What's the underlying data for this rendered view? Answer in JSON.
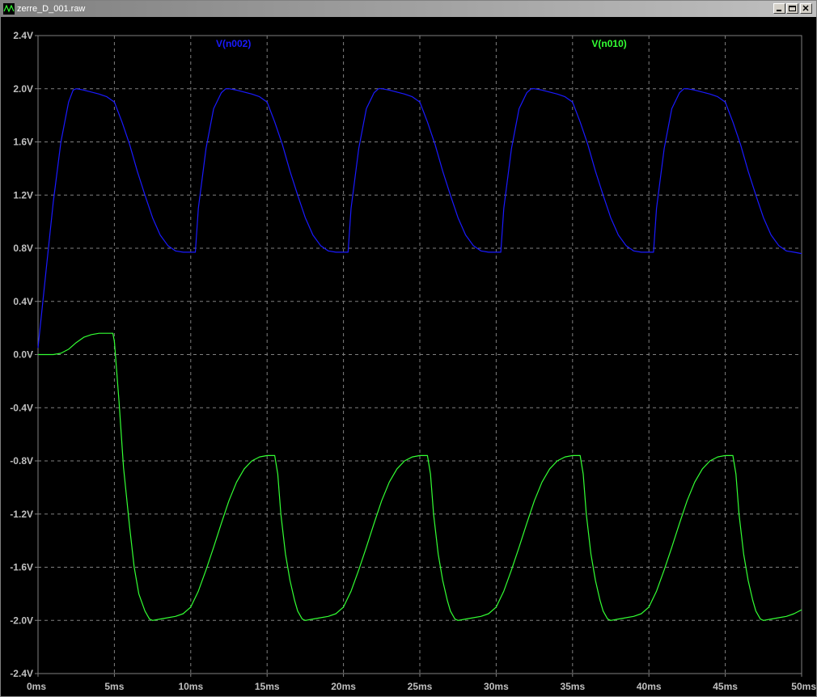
{
  "window": {
    "title": "zerre_D_001.raw",
    "buttons": [
      "minimize-icon",
      "restore-icon",
      "close-icon"
    ]
  },
  "colors": {
    "background": "#000000",
    "grid": "#808080",
    "axis": "#808080",
    "tick_text": "#c0c0c0",
    "series_n002": "#1a1aff",
    "series_n010": "#33ff33"
  },
  "chart_data": {
    "type": "line",
    "title": "",
    "xlabel": "",
    "ylabel": "",
    "x_unit": "ms",
    "y_unit": "V",
    "xlim": [
      0,
      50
    ],
    "ylim": [
      -2.4,
      2.4
    ],
    "x_ticks": [
      "0ms",
      "5ms",
      "10ms",
      "15ms",
      "20ms",
      "25ms",
      "30ms",
      "35ms",
      "40ms",
      "45ms",
      "50ms"
    ],
    "y_ticks": [
      "2.4V",
      "2.0V",
      "1.6V",
      "1.2V",
      "0.8V",
      "0.4V",
      "0.0V",
      "-0.4V",
      "-0.8V",
      "-1.2V",
      "-1.6V",
      "-2.0V",
      "-2.4V"
    ],
    "y_tick_values": [
      2.4,
      2.0,
      1.6,
      1.2,
      0.8,
      0.4,
      0.0,
      -0.4,
      -0.8,
      -1.2,
      -1.6,
      -2.0,
      -2.4
    ],
    "x_tick_values": [
      0,
      5,
      10,
      15,
      20,
      25,
      30,
      35,
      40,
      45,
      50
    ],
    "grid": true,
    "series": [
      {
        "name": "V(n002)",
        "color": "#1a1aff",
        "x": [
          0,
          0.5,
          1.0,
          1.5,
          2.0,
          2.3,
          2.5,
          3.0,
          4.0,
          4.5,
          5.0,
          5.5,
          6.0,
          6.5,
          7.0,
          7.5,
          8.0,
          8.5,
          9.0,
          9.5,
          10.0,
          10.3,
          10.5,
          11.0,
          11.5,
          12.0,
          12.3,
          12.5,
          13.0,
          14.0,
          14.5,
          15.0,
          15.5,
          16.0,
          16.5,
          17.0,
          17.5,
          18.0,
          18.5,
          19.0,
          19.5,
          20.0,
          20.3,
          20.5,
          21.0,
          21.5,
          22.0,
          22.3,
          22.5,
          23.0,
          24.0,
          24.5,
          25.0,
          25.5,
          26.0,
          26.5,
          27.0,
          27.5,
          28.0,
          28.5,
          29.0,
          29.5,
          30.0,
          30.3,
          30.5,
          31.0,
          31.5,
          32.0,
          32.3,
          32.5,
          33.0,
          34.0,
          34.5,
          35.0,
          35.5,
          36.0,
          36.5,
          37.0,
          37.5,
          38.0,
          38.5,
          39.0,
          39.5,
          40.0,
          40.3,
          40.5,
          41.0,
          41.5,
          42.0,
          42.3,
          42.5,
          43.0,
          44.0,
          44.5,
          45.0,
          45.5,
          46.0,
          46.5,
          47.0,
          47.5,
          48.0,
          48.5,
          49.0,
          49.5,
          50.0
        ],
        "y": [
          0.05,
          0.6,
          1.15,
          1.6,
          1.9,
          1.99,
          2.0,
          1.99,
          1.96,
          1.94,
          1.9,
          1.75,
          1.58,
          1.38,
          1.2,
          1.03,
          0.9,
          0.82,
          0.78,
          0.77,
          0.77,
          0.77,
          1.1,
          1.55,
          1.85,
          1.97,
          2.0,
          2.0,
          1.99,
          1.96,
          1.94,
          1.9,
          1.75,
          1.58,
          1.38,
          1.2,
          1.03,
          0.9,
          0.82,
          0.78,
          0.77,
          0.77,
          0.77,
          1.1,
          1.55,
          1.85,
          1.97,
          2.0,
          2.0,
          1.99,
          1.96,
          1.94,
          1.9,
          1.75,
          1.58,
          1.38,
          1.2,
          1.03,
          0.9,
          0.82,
          0.78,
          0.77,
          0.77,
          0.77,
          1.1,
          1.55,
          1.85,
          1.97,
          2.0,
          2.0,
          1.99,
          1.96,
          1.94,
          1.9,
          1.75,
          1.58,
          1.38,
          1.2,
          1.03,
          0.9,
          0.82,
          0.78,
          0.77,
          0.77,
          0.77,
          1.1,
          1.55,
          1.85,
          1.97,
          2.0,
          2.0,
          1.99,
          1.96,
          1.94,
          1.9,
          1.75,
          1.58,
          1.38,
          1.2,
          1.03,
          0.9,
          0.82,
          0.78,
          0.77,
          0.76
        ]
      },
      {
        "name": "V(n010)",
        "color": "#33ff33",
        "x": [
          0,
          0.5,
          1.0,
          1.5,
          2.0,
          2.5,
          3.0,
          3.5,
          4.0,
          4.5,
          4.9,
          5.0,
          5.3,
          5.6,
          6.0,
          6.3,
          6.6,
          7.0,
          7.3,
          7.5,
          8.0,
          9.0,
          9.5,
          10.0,
          10.5,
          11.0,
          11.5,
          12.0,
          12.5,
          13.0,
          13.5,
          14.0,
          14.5,
          15.0,
          15.5,
          15.7,
          15.9,
          16.2,
          16.5,
          16.8,
          17.0,
          17.3,
          17.5,
          18.0,
          19.0,
          19.5,
          20.0,
          20.5,
          21.0,
          21.5,
          22.0,
          22.5,
          23.0,
          23.5,
          24.0,
          24.5,
          25.0,
          25.5,
          25.7,
          25.9,
          26.2,
          26.5,
          26.8,
          27.0,
          27.3,
          27.5,
          28.0,
          29.0,
          29.5,
          30.0,
          30.5,
          31.0,
          31.5,
          32.0,
          32.5,
          33.0,
          33.5,
          34.0,
          34.5,
          35.0,
          35.5,
          35.7,
          35.9,
          36.2,
          36.5,
          36.8,
          37.0,
          37.3,
          37.5,
          38.0,
          39.0,
          39.5,
          40.0,
          40.5,
          41.0,
          41.5,
          42.0,
          42.5,
          43.0,
          43.5,
          44.0,
          44.5,
          45.0,
          45.5,
          45.7,
          45.9,
          46.2,
          46.5,
          46.8,
          47.0,
          47.3,
          47.5,
          48.0,
          49.0,
          49.5,
          50.0
        ],
        "y": [
          0.0,
          0.0,
          0.0,
          0.01,
          0.04,
          0.09,
          0.13,
          0.15,
          0.16,
          0.16,
          0.16,
          0.1,
          -0.35,
          -0.85,
          -1.3,
          -1.6,
          -1.8,
          -1.93,
          -1.99,
          -2.0,
          -1.99,
          -1.97,
          -1.95,
          -1.9,
          -1.78,
          -1.62,
          -1.45,
          -1.27,
          -1.1,
          -0.96,
          -0.86,
          -0.8,
          -0.77,
          -0.76,
          -0.76,
          -0.9,
          -1.2,
          -1.5,
          -1.7,
          -1.85,
          -1.93,
          -1.99,
          -2.0,
          -1.99,
          -1.97,
          -1.95,
          -1.9,
          -1.78,
          -1.62,
          -1.45,
          -1.27,
          -1.1,
          -0.96,
          -0.86,
          -0.8,
          -0.77,
          -0.76,
          -0.76,
          -0.9,
          -1.2,
          -1.5,
          -1.7,
          -1.85,
          -1.93,
          -1.99,
          -2.0,
          -1.99,
          -1.97,
          -1.95,
          -1.9,
          -1.78,
          -1.62,
          -1.45,
          -1.27,
          -1.1,
          -0.96,
          -0.86,
          -0.8,
          -0.77,
          -0.76,
          -0.76,
          -0.9,
          -1.2,
          -1.5,
          -1.7,
          -1.85,
          -1.93,
          -1.99,
          -2.0,
          -1.99,
          -1.97,
          -1.95,
          -1.9,
          -1.78,
          -1.62,
          -1.45,
          -1.27,
          -1.1,
          -0.96,
          -0.86,
          -0.8,
          -0.77,
          -0.76,
          -0.76,
          -0.9,
          -1.2,
          -1.5,
          -1.7,
          -1.85,
          -1.93,
          -1.99,
          -2.0,
          -1.99,
          -1.97,
          -1.95,
          -1.92
        ]
      }
    ]
  }
}
